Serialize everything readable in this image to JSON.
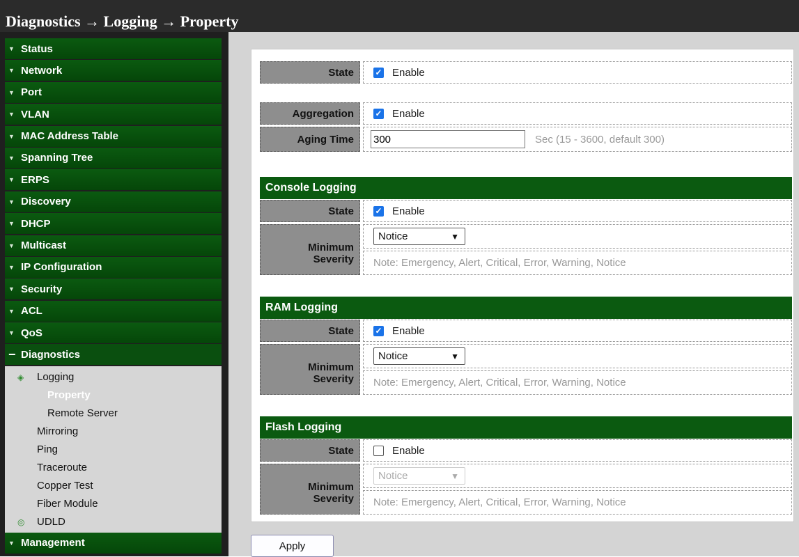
{
  "breadcrumb": {
    "title": "Diagnostics → Logging → Property"
  },
  "sidebar": {
    "items_top": [
      {
        "label": "Status"
      },
      {
        "label": "Network"
      },
      {
        "label": "Port"
      },
      {
        "label": "VLAN"
      },
      {
        "label": "MAC Address Table"
      },
      {
        "label": "Spanning Tree"
      },
      {
        "label": "ERPS"
      },
      {
        "label": "Discovery"
      },
      {
        "label": "DHCP"
      },
      {
        "label": "Multicast"
      },
      {
        "label": "IP Configuration"
      },
      {
        "label": "Security"
      },
      {
        "label": "ACL"
      },
      {
        "label": "QoS"
      }
    ],
    "open_item": {
      "label": "Diagnostics",
      "expander": "−"
    },
    "submenu": {
      "logging": "Logging",
      "property": "Property",
      "remote_server": "Remote Server",
      "mirroring": "Mirroring",
      "ping": "Ping",
      "traceroute": "Traceroute",
      "copper_test": "Copper Test",
      "fiber_module": "Fiber Module",
      "udld": "UDLD"
    },
    "items_bottom": [
      {
        "label": "Management"
      }
    ]
  },
  "form": {
    "state": {
      "label": "State",
      "checked": true,
      "option": "Enable"
    },
    "aggregation": {
      "label": "Aggregation",
      "checked": true,
      "option": "Enable"
    },
    "aging_time": {
      "label": "Aging Time",
      "value": "300",
      "hint": "Sec (15 - 3600, default 300)"
    },
    "console": {
      "header": "Console Logging",
      "state_label": "State",
      "state_checked": true,
      "state_option": "Enable",
      "severity_label_1": "Minimum",
      "severity_label_2": "Severity",
      "severity_value": "Notice",
      "note": "Note: Emergency, Alert, Critical, Error, Warning, Notice"
    },
    "ram": {
      "header": "RAM Logging",
      "state_label": "State",
      "state_checked": true,
      "state_option": "Enable",
      "severity_label_1": "Minimum",
      "severity_label_2": "Severity",
      "severity_value": "Notice",
      "note": "Note: Emergency, Alert, Critical, Error, Warning, Notice"
    },
    "flash": {
      "header": "Flash Logging",
      "state_label": "State",
      "state_checked": false,
      "state_option": "Enable",
      "severity_label_1": "Minimum",
      "severity_label_2": "Severity",
      "severity_value": "Notice",
      "severity_disabled": true,
      "note": "Note: Emergency, Alert, Critical, Error, Warning, Notice"
    },
    "apply_label": "Apply"
  },
  "colors": {
    "menu_green": "#0b5a10",
    "label_gray": "#8e8e8e",
    "checkbox_blue": "#1a73e8"
  }
}
